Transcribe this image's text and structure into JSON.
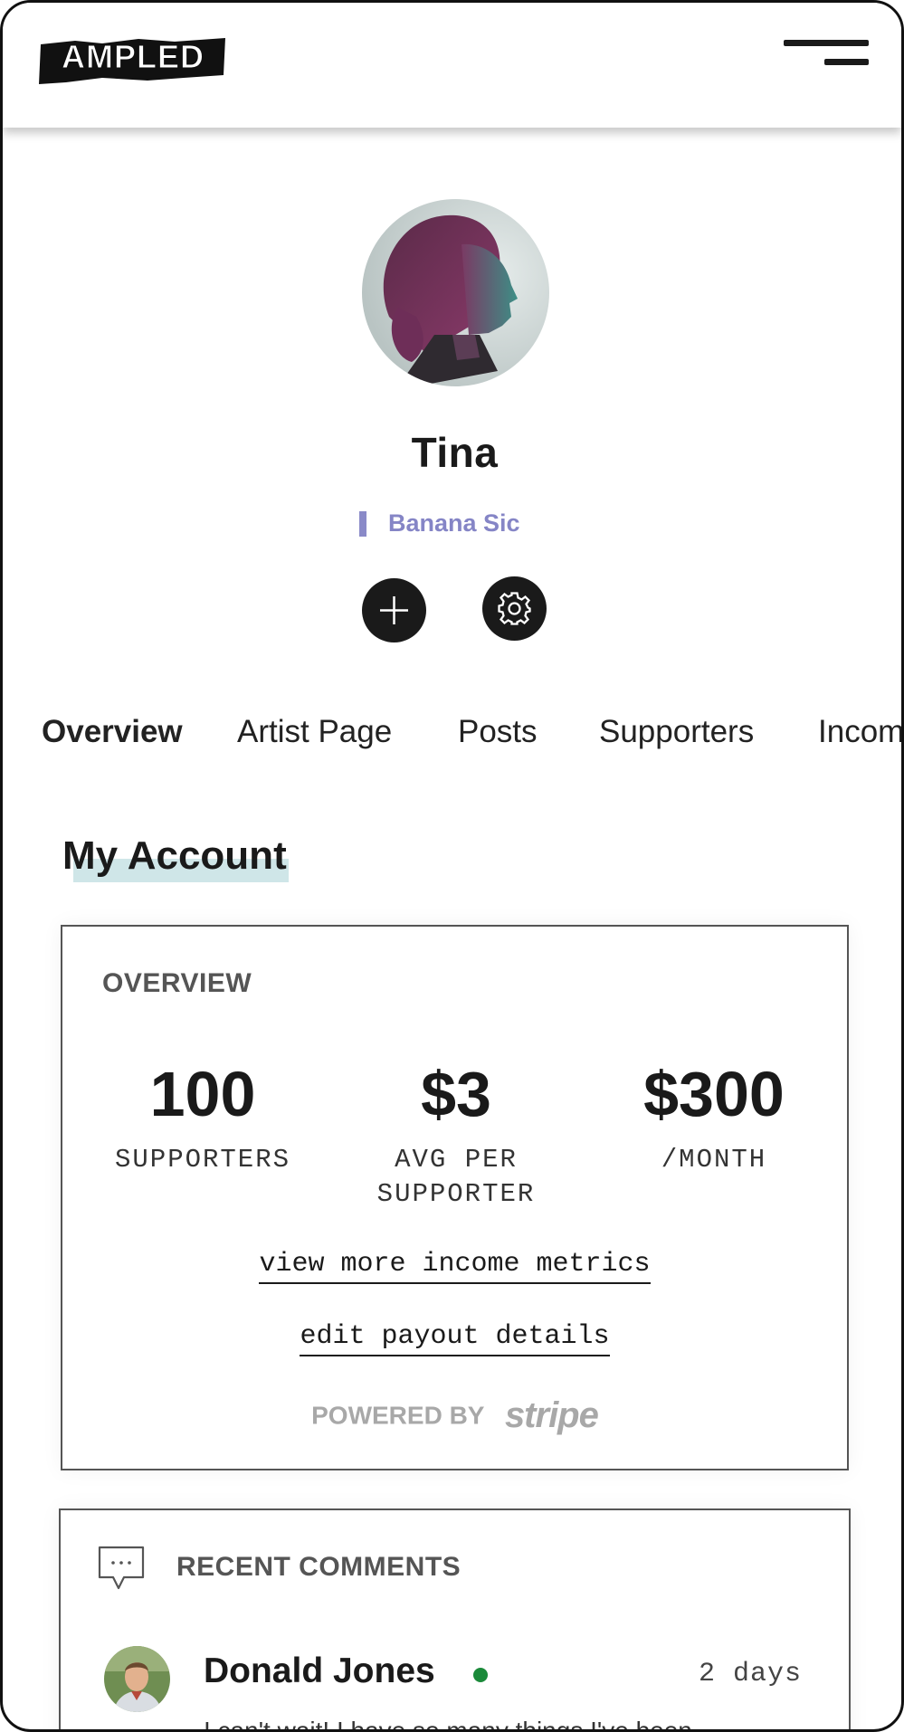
{
  "header": {
    "logo_text": "AMPLED",
    "menu_icon": "hamburger-menu-icon"
  },
  "profile": {
    "name": "Tina",
    "artist_name": "Banana Sic",
    "avatar": "profile-photo",
    "actions": [
      {
        "icon": "plus-icon"
      },
      {
        "icon": "gear-icon"
      }
    ]
  },
  "tabs": [
    "Overview",
    "Artist Page",
    "Posts",
    "Supporters",
    "Incom"
  ],
  "active_tab": "Overview",
  "my_account": {
    "title": "My Account",
    "overview": {
      "label": "OVERVIEW",
      "stats": [
        {
          "value": "100",
          "label": "SUPPORTERS"
        },
        {
          "value": "$3",
          "label_line1": "AVG PER",
          "label_line2": "SUPPORTER"
        },
        {
          "value": "$300",
          "label": "/MONTH"
        }
      ],
      "view_more_link": "view more income metrics",
      "edit_payout_link": "edit payout details",
      "powered_by": "POWERED BY",
      "provider": "stripe"
    },
    "recent_comments": {
      "label": "RECENT COMMENTS",
      "icon": "comment-icon",
      "comments": [
        {
          "author": "Donald Jones",
          "online": true,
          "time": "2 days",
          "text": "I can't wait! I have so many things I've been"
        }
      ]
    }
  },
  "colors": {
    "accent_purple": "#8585c6",
    "highlight": "#cfe6e8",
    "online_green": "#1b8a3a",
    "stripe_gray": "#a8a8a8"
  }
}
